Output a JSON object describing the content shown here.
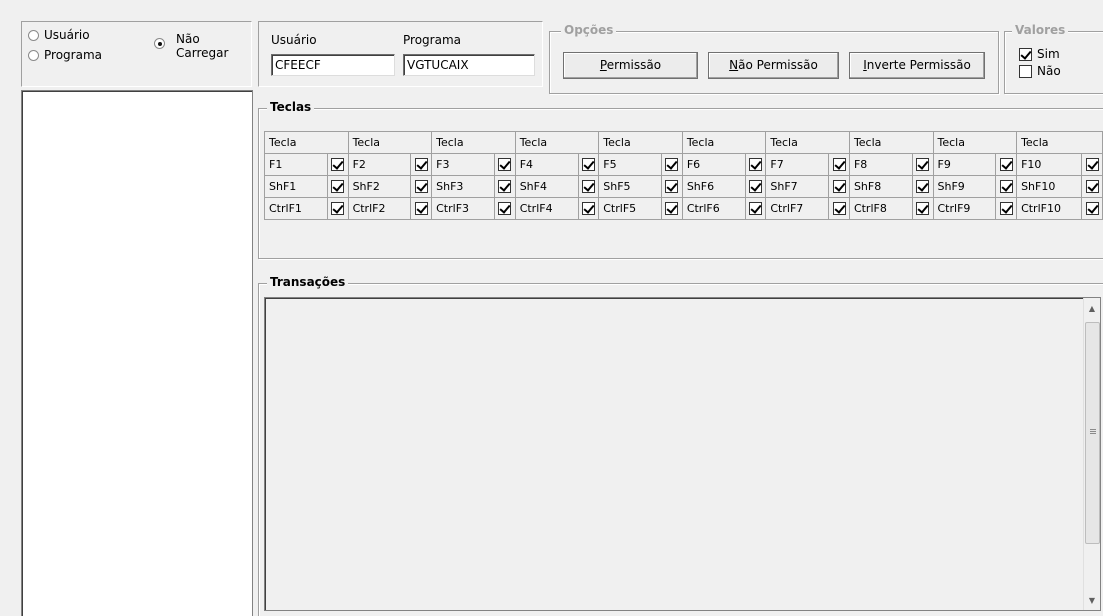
{
  "left_panel": {
    "radio_usuario": "Usuário",
    "radio_programa": "Programa",
    "radio_nao_carregar_line1": "Não",
    "radio_nao_carregar_line2": "Carregar",
    "selected": "nao_carregar"
  },
  "fields": {
    "usuario_label": "Usuário",
    "usuario_value": "CFEECF",
    "programa_label": "Programa",
    "programa_value": "VGTUCAIX"
  },
  "opcoes": {
    "title": "Opções",
    "permissao_mnemonic": "P",
    "permissao_rest": "ermissão",
    "nao_permissao_mnemonic": "N",
    "nao_permissao_rest": "ão Permissão",
    "inverte_mnemonic": "I",
    "inverte_rest": "nverte Permissão"
  },
  "valores": {
    "title": "Valores",
    "sim": "Sim",
    "sim_checked": true,
    "nao": "Não",
    "nao_checked": false
  },
  "teclas": {
    "title": "Teclas",
    "header": "Tecla",
    "rows": [
      [
        "F1",
        "F2",
        "F3",
        "F4",
        "F5",
        "F6",
        "F7",
        "F8",
        "F9",
        "F10"
      ],
      [
        "ShF1",
        "ShF2",
        "ShF3",
        "ShF4",
        "ShF5",
        "ShF6",
        "ShF7",
        "ShF8",
        "ShF9",
        "ShF10"
      ],
      [
        "CtrlF1",
        "CtrlF2",
        "CtrlF3",
        "CtrlF4",
        "CtrlF5",
        "CtrlF6",
        "CtrlF7",
        "CtrlF8",
        "CtrlF9",
        "CtrlF10"
      ]
    ],
    "all_checked": true
  },
  "transacoes": {
    "title": "Transações"
  }
}
